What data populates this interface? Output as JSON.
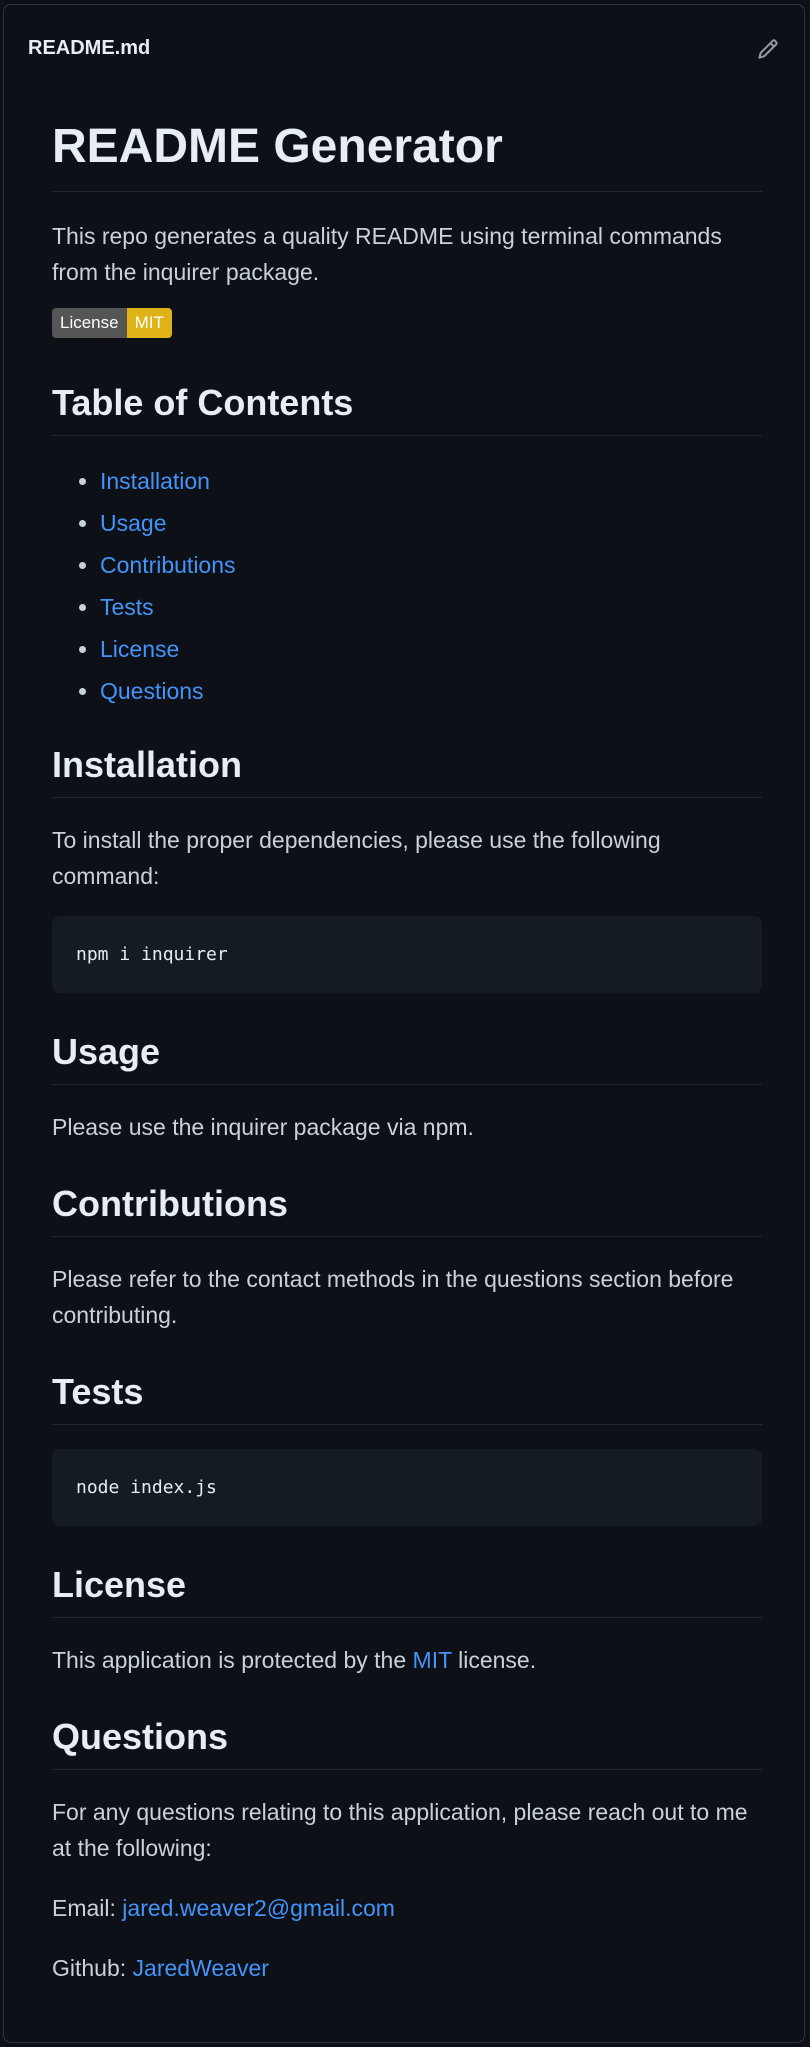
{
  "file": {
    "name": "README.md",
    "edit_icon": "pencil-icon"
  },
  "readme": {
    "title": "README Generator",
    "description": "This repo generates a quality README using terminal commands from the inquirer package.",
    "badge": {
      "label": "License",
      "value": "MIT",
      "label_color": "#555555",
      "value_color": "#dfb317"
    },
    "toc": {
      "heading": "Table of Contents",
      "items": [
        "Installation",
        "Usage",
        "Contributions",
        "Tests",
        "License",
        "Questions"
      ]
    },
    "installation": {
      "heading": "Installation",
      "text": "To install the proper dependencies, please use the following command:",
      "code": "npm i inquirer"
    },
    "usage": {
      "heading": "Usage",
      "text": "Please use the inquirer package via npm."
    },
    "contributions": {
      "heading": "Contributions",
      "text": "Please refer to the contact methods in the questions section before contributing."
    },
    "tests": {
      "heading": "Tests",
      "code": "node index.js"
    },
    "license": {
      "heading": "License",
      "text_before": "This application is protected by the ",
      "link": "MIT",
      "text_after": " license."
    },
    "questions": {
      "heading": "Questions",
      "text": "For any questions relating to this application, please reach out to me at the following:",
      "email_label": "Email: ",
      "email": "jared.weaver2@gmail.com",
      "github_label": "Github: ",
      "github": "JaredWeaver"
    }
  },
  "colors": {
    "background": "#0d1117",
    "text": "#c9d1d9",
    "heading": "#e6edf3",
    "link": "#4493f8",
    "code_bg": "#151b23",
    "border": "#30363d"
  }
}
